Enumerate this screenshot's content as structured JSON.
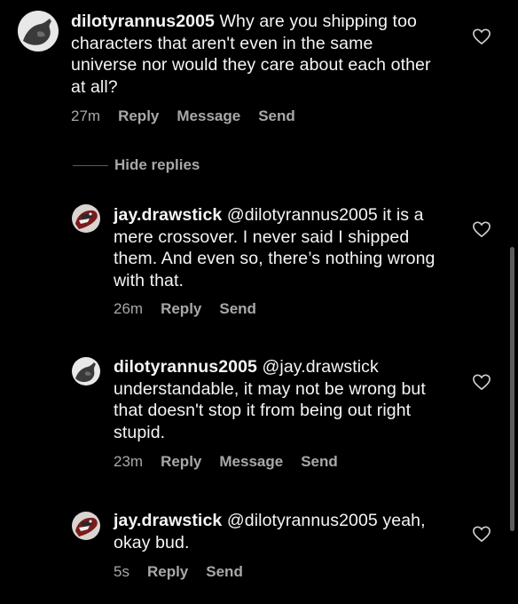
{
  "comments": [
    {
      "username": "dilotyrannus2005",
      "text": " Why are you shipping too characters that aren't even in the same universe nor would they care about each other at all?",
      "time": "27m",
      "actions": [
        "Reply",
        "Message",
        "Send"
      ]
    },
    {
      "username": "jay.drawstick",
      "text": " @dilotyrannus2005 it is a mere crossover. I never said I shipped them. And even so, there’s nothing wrong with that.",
      "time": "26m",
      "actions": [
        "Reply",
        "Send"
      ]
    },
    {
      "username": "dilotyrannus2005",
      "text": " @jay.drawstick understandable, it may not be wrong but that doesn't stop it from being out right stupid.",
      "time": "23m",
      "actions": [
        "Reply",
        "Message",
        "Send"
      ]
    },
    {
      "username": "jay.drawstick",
      "text": " @dilotyrannus2005 yeah, okay bud.",
      "time": "5s",
      "actions": [
        "Reply",
        "Send"
      ]
    }
  ],
  "hide_replies": "Hide replies",
  "colors": {
    "background": "#000000",
    "text": "#f5f5f5",
    "muted": "#a8a8a8"
  },
  "icons": {
    "like": "heart-outline-icon"
  }
}
